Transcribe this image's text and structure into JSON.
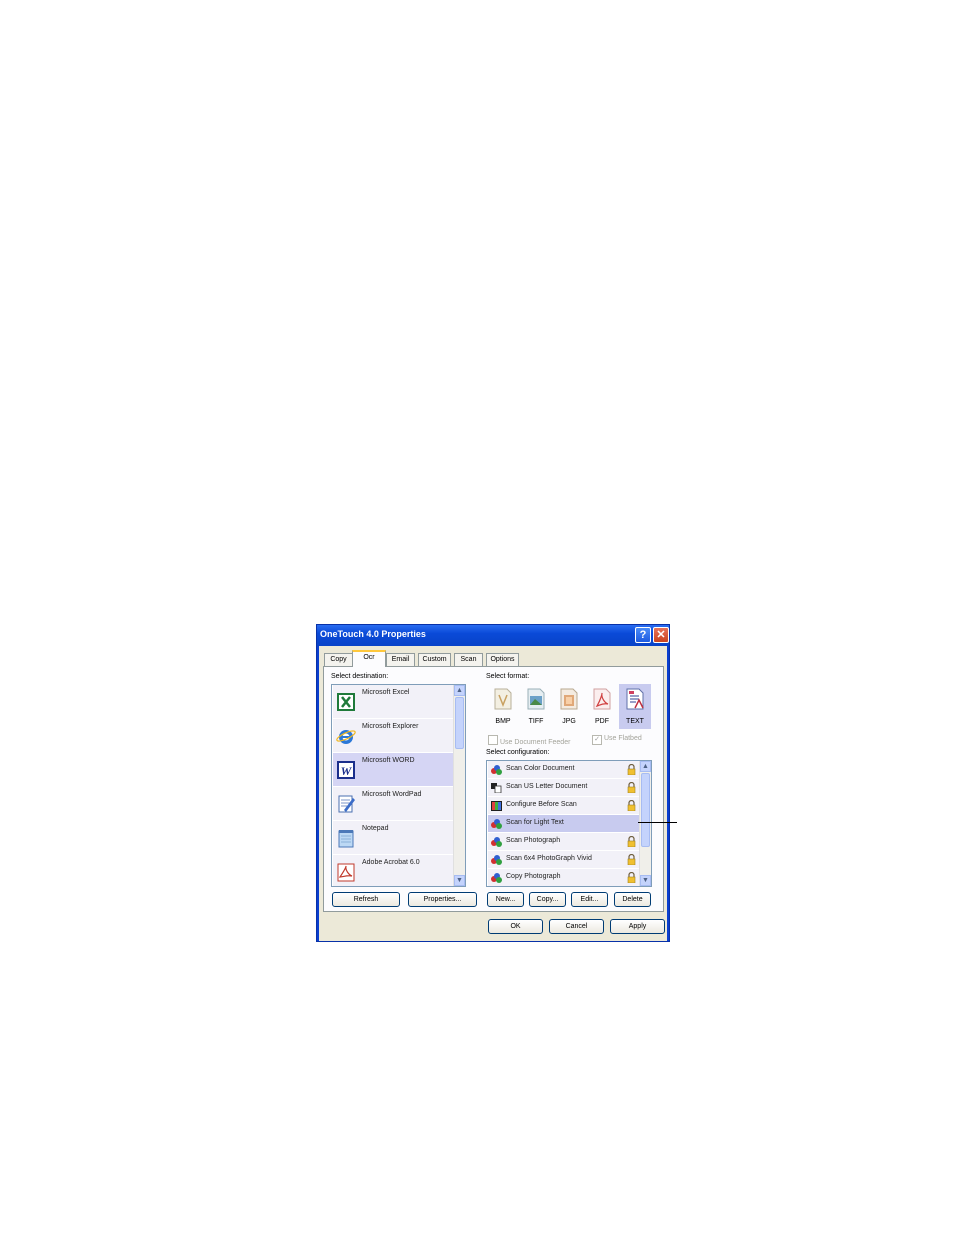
{
  "window": {
    "title": "OneTouch 4.0 Properties",
    "help_glyph": "?",
    "close_glyph": "✕"
  },
  "tabs": [
    "Copy",
    "Ocr",
    "Email",
    "Custom",
    "Scan",
    "Options"
  ],
  "active_tab": "Ocr",
  "destination": {
    "label": "Select destination:",
    "items": [
      "Microsoft Excel",
      "Microsoft Explorer",
      "Microsoft WORD",
      "Microsoft WordPad",
      "Notepad",
      "Adobe Acrobat 6.0"
    ],
    "selected": "Microsoft WORD",
    "icons": [
      "excel-icon",
      "internet-explorer-icon",
      "word-icon",
      "wordpad-icon",
      "notepad-icon",
      "acrobat-icon"
    ],
    "refresh_label": "Refresh",
    "properties_label": "Properties..."
  },
  "format": {
    "label": "Select format:",
    "items": [
      "BMP",
      "TIFF",
      "JPG",
      "PDF",
      "TEXT"
    ],
    "selected": "TEXT",
    "use_document_feeder": "Use Document Feeder",
    "use_flatbed": "Use Flatbed",
    "use_flatbed_checked": true
  },
  "configuration": {
    "label": "Select configuration:",
    "items": [
      "Scan Color Document",
      "Scan US Letter Document",
      "Configure Before Scan",
      "Scan for Light Text",
      "Scan Photograph",
      "Scan 6x4 PhotoGraph Vivid",
      "Copy Photograph"
    ],
    "selected": "Scan for Light Text",
    "locked": [
      true,
      true,
      true,
      false,
      true,
      true,
      true
    ],
    "new_label": "New...",
    "copy_label": "Copy...",
    "edit_label": "Edit...",
    "delete_label": "Delete"
  },
  "footer": {
    "ok_label": "OK",
    "cancel_label": "Cancel",
    "apply_label": "Apply"
  },
  "colors": {
    "title_bar": "#0a4ad8",
    "dialog_bg": "#ece9d8",
    "selection": "#c8cbef",
    "close_button": "#c9431f"
  }
}
